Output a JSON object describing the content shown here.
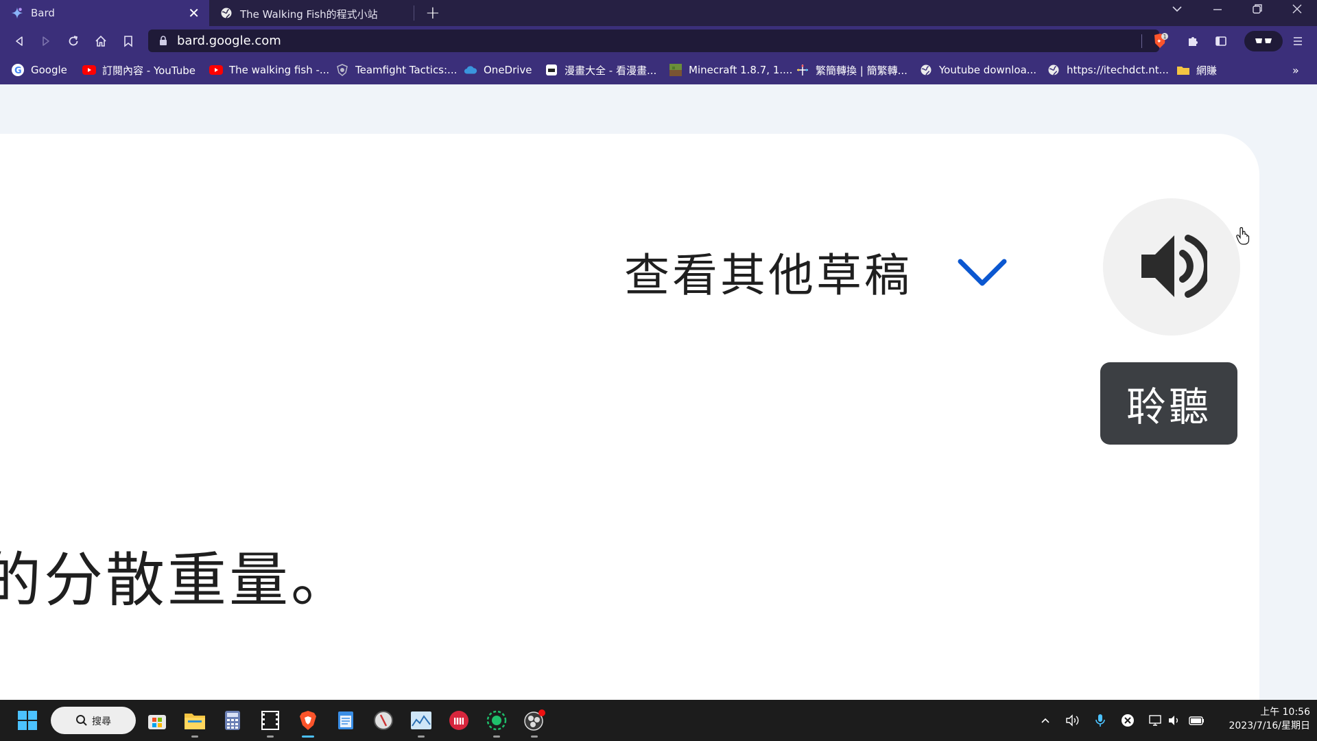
{
  "browser": {
    "tabs": [
      {
        "title": "Bard",
        "active": true
      },
      {
        "title": "The Walking Fish的程式小站",
        "active": false
      }
    ],
    "new_tab": "+",
    "address": "bard.google.com",
    "bookmarks": [
      {
        "label": "Google",
        "icon": "google-icon"
      },
      {
        "label": "訂閱內容 - YouTube",
        "icon": "youtube-icon"
      },
      {
        "label": "The walking fish -...",
        "icon": "youtube-icon"
      },
      {
        "label": "Teamfight Tactics:...",
        "icon": "shield-icon"
      },
      {
        "label": "OneDrive",
        "icon": "cloud-icon"
      },
      {
        "label": "漫畫大全 - 看漫畫...",
        "icon": "manga-icon"
      },
      {
        "label": "Minecraft 1.8.7, 1....",
        "icon": "minecraft-icon"
      },
      {
        "label": "繁簡轉換 | 簡繁轉...",
        "icon": "sparkle-icon"
      },
      {
        "label": "Youtube downloa...",
        "icon": "globe-icon"
      },
      {
        "label": "https://itechdct.nt...",
        "icon": "globe-icon"
      },
      {
        "label": "網賺",
        "icon": "folder-icon"
      }
    ],
    "more_bookmarks": "»"
  },
  "page": {
    "view_drafts_label": "查看其他草稿",
    "listen_tooltip": "聆聽",
    "answer_fragment": "的分散重量。"
  },
  "taskbar": {
    "search_label": "搜尋",
    "clock_time": "上午 10:56",
    "clock_date": "2023/7/16/星期日"
  },
  "colors": {
    "tab_bar": "#262043",
    "toolbar": "#3b2f7a",
    "page_bg": "#f0f4f9",
    "accent_chevron": "#0b57d0",
    "tooltip_bg": "#3c3f43"
  }
}
